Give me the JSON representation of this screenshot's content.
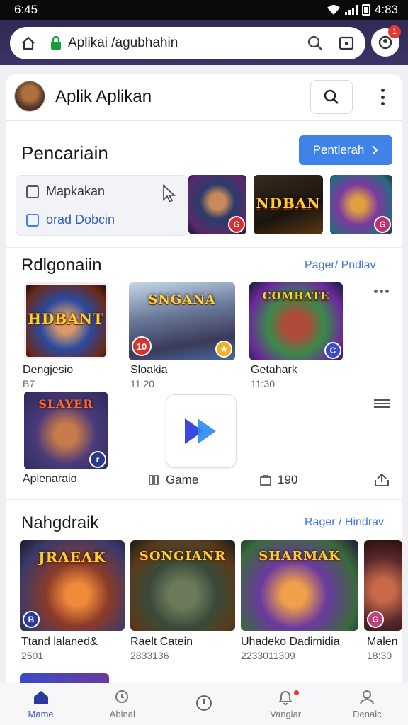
{
  "status": {
    "time": "6:45",
    "right_text": "4:83"
  },
  "browser": {
    "url": "Aplikai /agubhahin",
    "notification_count": "1"
  },
  "app": {
    "title": "Aplik Aplikan"
  },
  "search_section": {
    "title": "Pencariain",
    "cta_label": "Pentlerah",
    "filters": [
      {
        "label": "Mapkakan"
      },
      {
        "label": "orad Dobcin"
      }
    ]
  },
  "featured": [
    {
      "art_text": "",
      "badge": ""
    },
    {
      "art_text": "NDBAN",
      "badge": ""
    },
    {
      "art_text": "",
      "badge": ""
    }
  ],
  "recommend": {
    "title": "Rdlgonaiin",
    "link": "Pager/ Pndlav",
    "games": [
      {
        "art_text": "HDBANT",
        "title": "Dengjesio",
        "sub": "B7",
        "badge": ""
      },
      {
        "art_text": "SNGANA",
        "title": "Sloakia",
        "sub": "11:20",
        "badge": "10"
      },
      {
        "art_text": "COMBATE",
        "title": "Getahark",
        "sub": "11:30",
        "badge": ""
      },
      {
        "art_text": "SLAYER",
        "title": "Aplenaraio",
        "sub": "",
        "badge": ""
      }
    ],
    "tile_stats": [
      {
        "label": "Game"
      },
      {
        "label": "190"
      }
    ]
  },
  "popular": {
    "title": "Nahgdraik",
    "link": "Rager / Hindrav",
    "games": [
      {
        "art_text": "JRAEAK",
        "title": "Ttand lalaned&",
        "sub": "2501"
      },
      {
        "art_text": "SONGIANR",
        "title": "Raelt Catein",
        "sub": "2833136"
      },
      {
        "art_text": "SHARMAK",
        "title": "Uhadeko Dadimidia",
        "sub": "2233011309"
      },
      {
        "art_text": "",
        "title": "Malen",
        "sub": "18:30"
      }
    ]
  },
  "nav": [
    {
      "label": "Mame"
    },
    {
      "label": "Abinal"
    },
    {
      "label": ""
    },
    {
      "label": "Vangiar"
    },
    {
      "label": "Denalc"
    }
  ],
  "colors": {
    "accent": "#3f82e8",
    "browser_bar": "#2f2a55",
    "nav_active": "#3a57c8"
  }
}
